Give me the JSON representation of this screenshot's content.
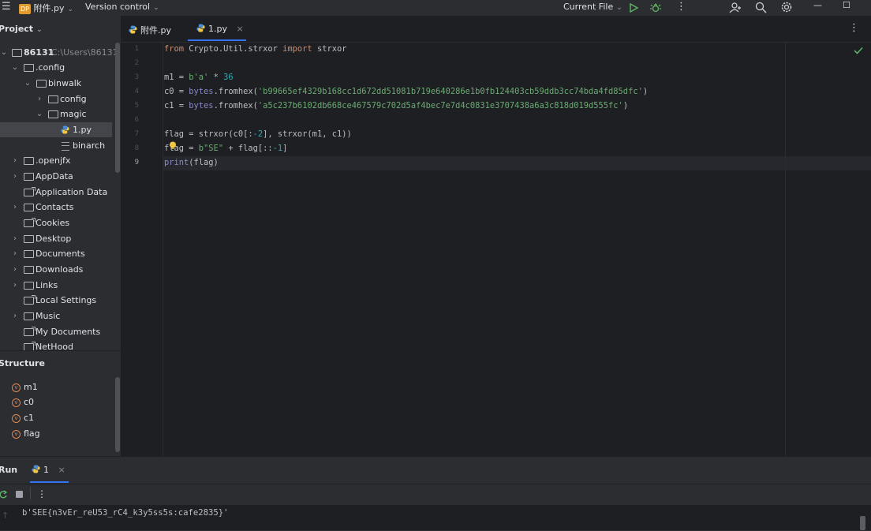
{
  "titlebar": {
    "project_badge": "DP",
    "project_name": "附件.py",
    "version_control": "Version control",
    "run_config": "Current File",
    "more": "⋮",
    "window_controls": [
      "—",
      "☐"
    ]
  },
  "project_panel": {
    "title": "Project",
    "tree": [
      {
        "label": "86131",
        "path": "C:\\Users\\86131"
      },
      {
        "label": ".config"
      },
      {
        "label": "binwalk"
      },
      {
        "label": "config"
      },
      {
        "label": "magic"
      },
      {
        "label": "1.py"
      },
      {
        "label": "binarch"
      },
      {
        "label": ".openjfx"
      },
      {
        "label": "AppData"
      },
      {
        "label": "Application Data"
      },
      {
        "label": "Contacts"
      },
      {
        "label": "Cookies"
      },
      {
        "label": "Desktop"
      },
      {
        "label": "Documents"
      },
      {
        "label": "Downloads"
      },
      {
        "label": "Links"
      },
      {
        "label": "Local Settings"
      },
      {
        "label": "Music"
      },
      {
        "label": "My Documents"
      },
      {
        "label": "NetHood"
      }
    ]
  },
  "structure_panel": {
    "title": "Structure",
    "items": [
      "m1",
      "c0",
      "c1",
      "flag"
    ],
    "var_badge": "v"
  },
  "editor": {
    "tabs": [
      {
        "label": "附件.py"
      },
      {
        "label": "1.py",
        "close": "×"
      }
    ],
    "more": "⋮",
    "check": "✓",
    "line_numbers": [
      "1",
      "2",
      "3",
      "4",
      "5",
      "6",
      "7",
      "8",
      "9"
    ],
    "code": {
      "l1_from": "from",
      "l1_mod": " Crypto.Util.strxor ",
      "l1_import": "import",
      "l1_name": " strxor",
      "l3_a": "m1 = ",
      "l3_str": "b'a'",
      "l3_op": " * ",
      "l3_num": "36",
      "l4_a": "c0 = ",
      "l4_bytes": "bytes",
      "l4_dot": ".",
      "l4_fn": "fromhex",
      "l4_open": "(",
      "l4_str": "'b99665ef4329b168cc1d672dd51081b719e640286e1b0fb124403cb59ddb3cc74bda4fd85dfc'",
      "l4_close": ")",
      "l5_a": "c1 = ",
      "l5_bytes": "bytes",
      "l5_dot": ".",
      "l5_fn": "fromhex",
      "l5_open": "(",
      "l5_str": "'a5c237b6102db668ce467579c702d5af4bec7e7d4c0831e3707438a6a3c818d019d555fc'",
      "l5_close": ")",
      "l7_a": "flag = strxor(c0[:",
      "l7_num": "-2",
      "l7_b": "], strxor(m1, c1))",
      "l8_a": "flag = ",
      "l8_str": "b\"SE\"",
      "l8_b": " + flag[::",
      "l8_num": "-1",
      "l8_c": "]",
      "l9_print": "print",
      "l9_rest": "(flag)"
    }
  },
  "run_panel": {
    "title": "Run",
    "tab_label": "1",
    "tab_close": "×",
    "output": "b'SEE{n3vEr_reU53_rC4_k3y5ss5s:cafe2835}'"
  },
  "colors": {
    "accent": "#3574f0",
    "keyword": "#cf8e6d",
    "string": "#6aab73",
    "number": "#2aacb8",
    "function": "#56a8f5",
    "run_green": "#5fb865"
  },
  "icons": [
    "menu-icon",
    "run-icon",
    "debug-icon",
    "add-user-icon",
    "search-icon",
    "settings-icon",
    "python-file-icon",
    "folder-icon",
    "linked-folder-icon",
    "variable-icon",
    "rerun-icon",
    "stop-icon",
    "bulb-icon",
    "check-icon"
  ]
}
